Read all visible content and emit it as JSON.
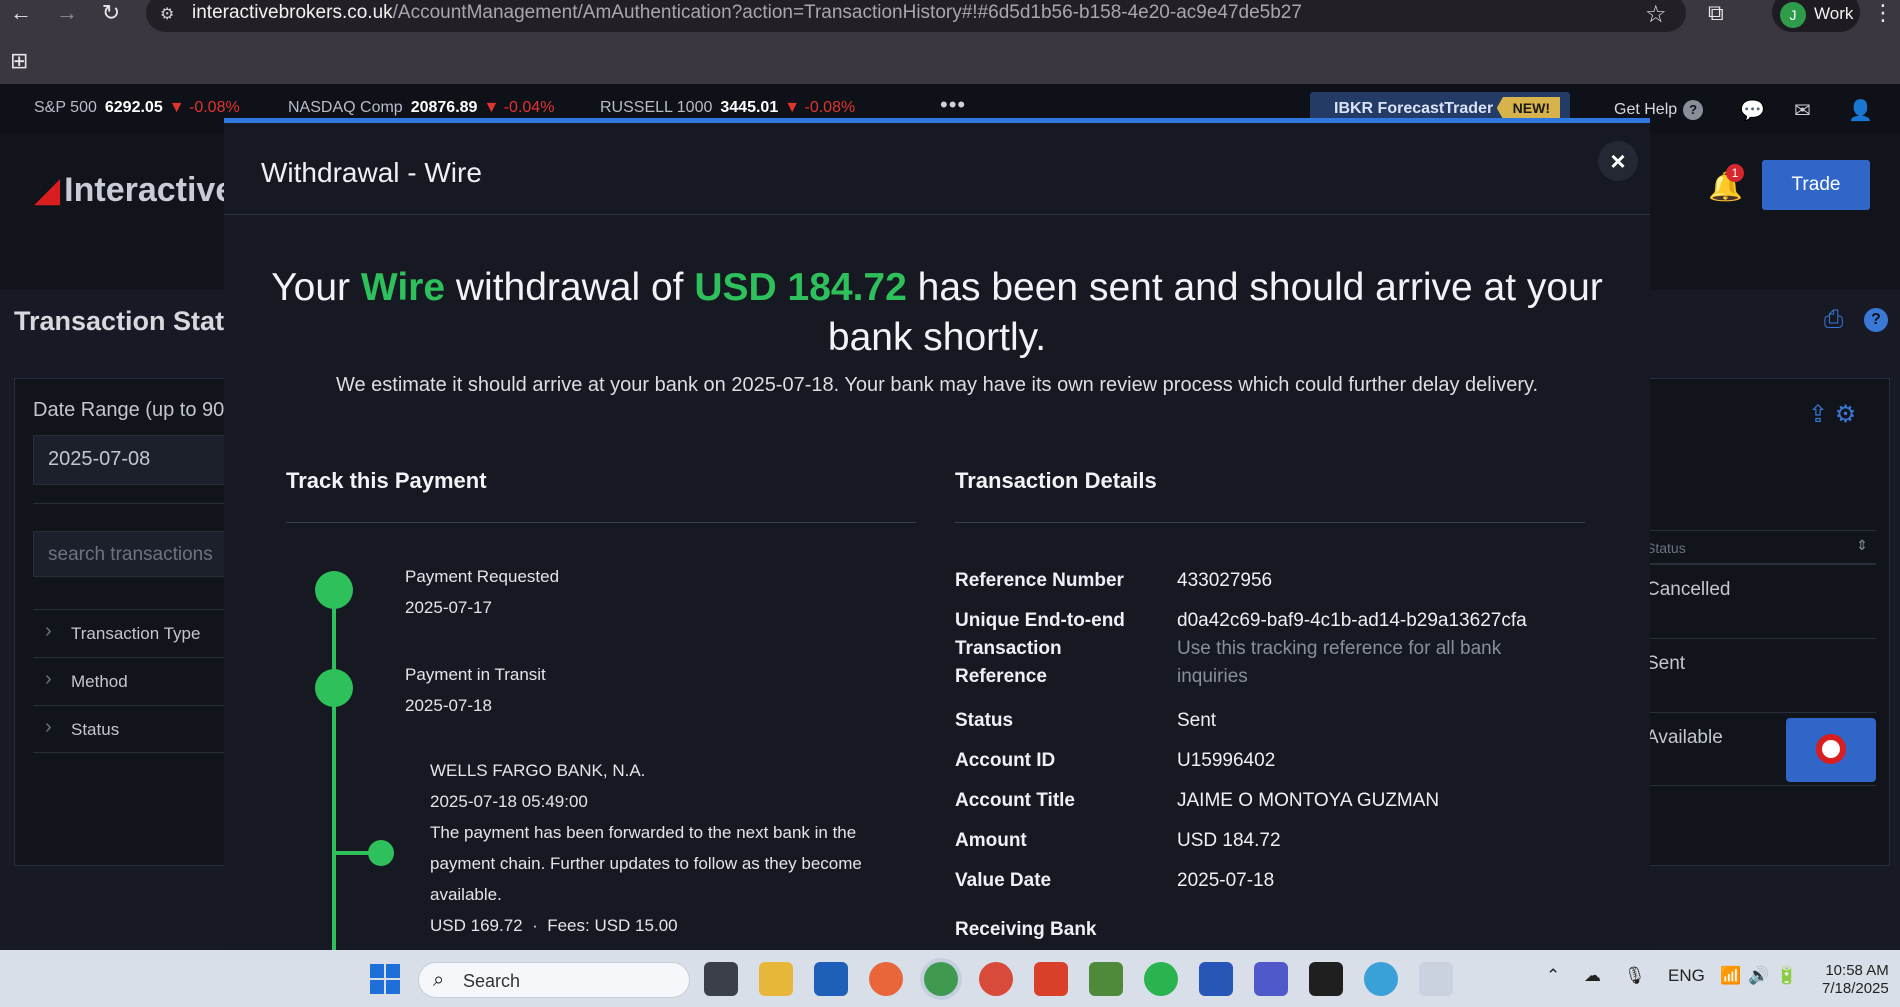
{
  "browser": {
    "url_host": "interactivebrokers.co.uk",
    "url_path": "/AccountManagement/AmAuthentication?action=TransactionHistory#!#6d5d1b56-b158-4e20-ac9e47de5b27",
    "profile_initial": "J",
    "profile_label": "Work"
  },
  "ticker": [
    {
      "name": "S&P 500",
      "value": "6292.05",
      "change": "▼ -0.08%"
    },
    {
      "name": "NASDAQ Comp",
      "value": "20876.89",
      "change": "▼ -0.04%"
    },
    {
      "name": "RUSSELL 1000",
      "value": "3445.01",
      "change": "▼ -0.08%"
    }
  ],
  "topbar": {
    "more": "•••",
    "forecast": "IBKR ForecastTrader",
    "new_badge": "NEW!",
    "get_help": "Get Help",
    "help_mark": "?"
  },
  "app": {
    "logo": "Interactive",
    "bell_count": "1",
    "trade": "Trade",
    "page_title": "Transaction Stat",
    "date_range_label": "Date Range (up to 90",
    "date_from": "2025-07-08",
    "search_placeholder": "search transactions",
    "filters": [
      "Transaction Type",
      "Method",
      "Status"
    ],
    "status_header": "Status",
    "status_values": [
      "Cancelled",
      "Sent",
      "Available"
    ]
  },
  "modal": {
    "title": "Withdrawal - Wire",
    "close": "×",
    "headline": {
      "p1": "Your ",
      "method": "Wire",
      "p2": " withdrawal of ",
      "amount": "USD 184.72",
      "p3": " has been sent and should arrive at your bank shortly."
    },
    "estimate": "We estimate it should arrive at your bank on 2025-07-18. Your bank may have its own review process which could further delay delivery.",
    "track_title": "Track this Payment",
    "details_title": "Transaction Details",
    "steps": [
      {
        "label": "Payment Requested",
        "date": "2025-07-17"
      },
      {
        "label": "Payment in Transit",
        "date": "2025-07-18"
      }
    ],
    "bank_update": {
      "bank": "WELLS FARGO BANK, N.A.",
      "time": "2025-07-18 05:49:00",
      "message": "The payment has been forwarded to the next bank in the payment chain. Further updates to follow as they become available.",
      "amount": "USD 169.72",
      "sep": "·",
      "fees": "Fees: USD 15.00"
    },
    "details": {
      "ref_label": "Reference Number",
      "ref_value": "433027956",
      "e2e_label": "Unique End-to-end Transaction Reference",
      "e2e_value": "d0a42c69-baf9-4c1b-ad14-b29a13627cfa",
      "e2e_hint": "Use this tracking reference for all bank inquiries",
      "status_label": "Status",
      "status_value": "Sent",
      "account_id_label": "Account ID",
      "account_id_value": "U15996402",
      "account_title_label": "Account Title",
      "account_title_value": "JAIME O MONTOYA GUZMAN",
      "amount_label": "Amount",
      "amount_value": "USD 184.72",
      "value_date_label": "Value Date",
      "value_date_value": "2025-07-18",
      "receiving_bank_label": "Receiving Bank"
    }
  },
  "taskbar": {
    "search": "Search",
    "lang": "ENG",
    "time": "10:58 AM",
    "date": "7/18/2025"
  }
}
